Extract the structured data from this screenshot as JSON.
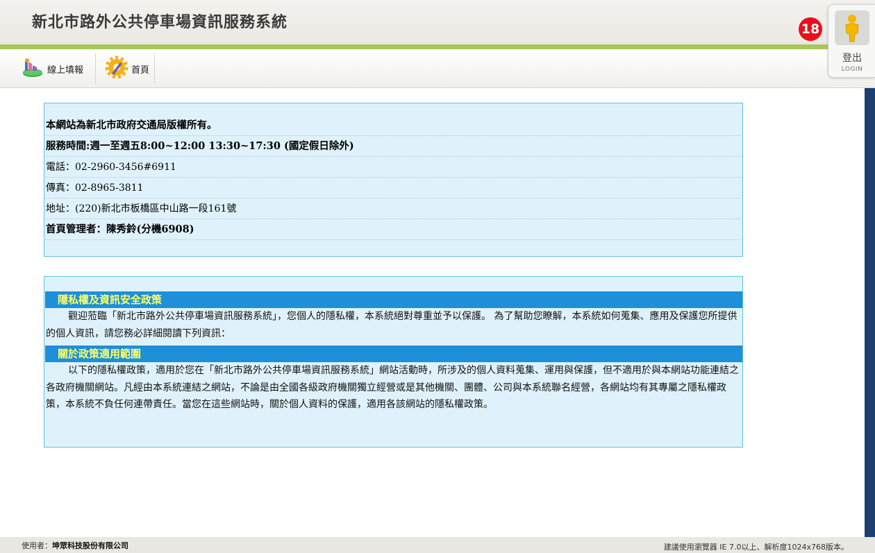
{
  "header": {
    "title": "新北市路外公共停車場資訊服務系統",
    "accent_color": "#a8c85a"
  },
  "menu": {
    "items": [
      {
        "label": "線上填報",
        "icon": "chart-report-icon"
      },
      {
        "label": "首頁",
        "icon": "gear-home-icon"
      }
    ]
  },
  "notification": {
    "count": "18",
    "color": "#e8101c"
  },
  "login": {
    "label": "登出",
    "sublabel": "LOGIN",
    "icon": "user-icon"
  },
  "info": {
    "rows": [
      {
        "text": "本網站為新北市政府交通局版權所有。",
        "bold": true
      },
      {
        "text": "服務時間:週一至週五8:00~12:00 13:30~17:30 (國定假日除外)",
        "bold": true
      },
      {
        "text": "電話：02-2960-3456#6911",
        "bold": false
      },
      {
        "text": "傳真：02-8965-3811",
        "bold": false
      },
      {
        "text": "地址：(220)新北市板橋區中山路一段161號",
        "bold": false
      },
      {
        "text": "首頁管理者：陳秀鈴(分機6908)",
        "bold": true
      }
    ]
  },
  "policy": {
    "heading1": "隱私權及資訊安全政策",
    "paragraph1": "觀迎蒞臨「新北市路外公共停車場資訊服務系統」，您個人的隱私權，本系統絕對尊重並予以保護。 為了幫助您瞭解，本系統如何蒐集、應用及保護您所提供的個人資訊，請您務必詳細閱讀下列資訊：",
    "heading2": "關於政策適用範圍",
    "paragraph2": "以下的隱私權政策，適用於您在「新北市路外公共停車場資訊服務系統」網站活動時，所涉及的個人資料蒐集、運用與保護，但不適用於與本網站功能連結之各政府機關網站。凡經由本系統連結之網站，不論是由全國各級政府機關獨立經營或是其他機關、團體、公司與本系統聯名經營，各網站均有其專屬之隱私權政策，本系統不負任何連帶責任。當您在這些網站時，關於個人資料的保護，適用各該網站的隱私權政策。",
    "heading_bg": "#1e8fd9",
    "heading_color": "#ffff66"
  },
  "footer": {
    "user_label": "使用者：",
    "user_name": "坤眾科技股份有限公司",
    "browser_note": "建議使用瀏覽器 IE 7.0以上、解析度1024x768版本。"
  }
}
